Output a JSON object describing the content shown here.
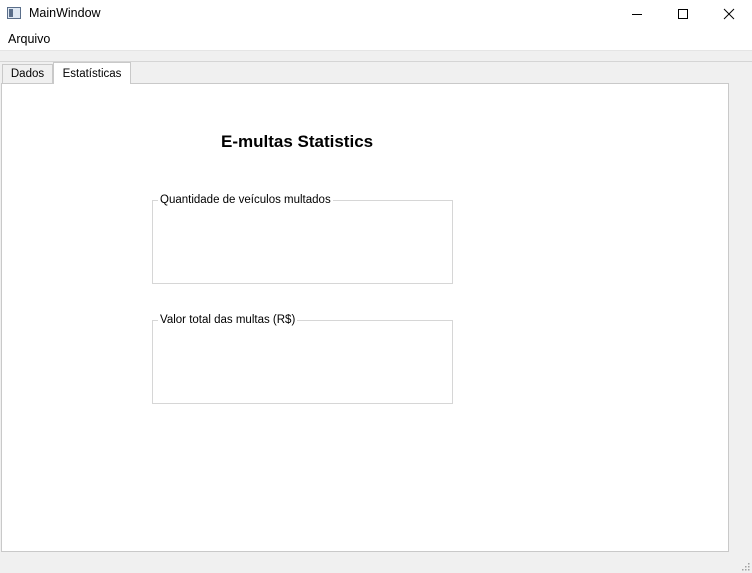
{
  "window": {
    "title": "MainWindow",
    "minimize_icon": "minimize-icon",
    "maximize_icon": "maximize-icon",
    "close_icon": "close-icon"
  },
  "menu": {
    "items": [
      {
        "label": "Arquivo"
      }
    ]
  },
  "tabs": [
    {
      "label": "Dados",
      "active": false
    },
    {
      "label": "Estatísticas",
      "active": true
    }
  ],
  "statistics": {
    "heading": "E-multas Statistics",
    "groups": [
      {
        "title": "Quantidade de veículos multados",
        "value": ""
      },
      {
        "title": "Valor total das multas (R$)",
        "value": ""
      }
    ]
  }
}
